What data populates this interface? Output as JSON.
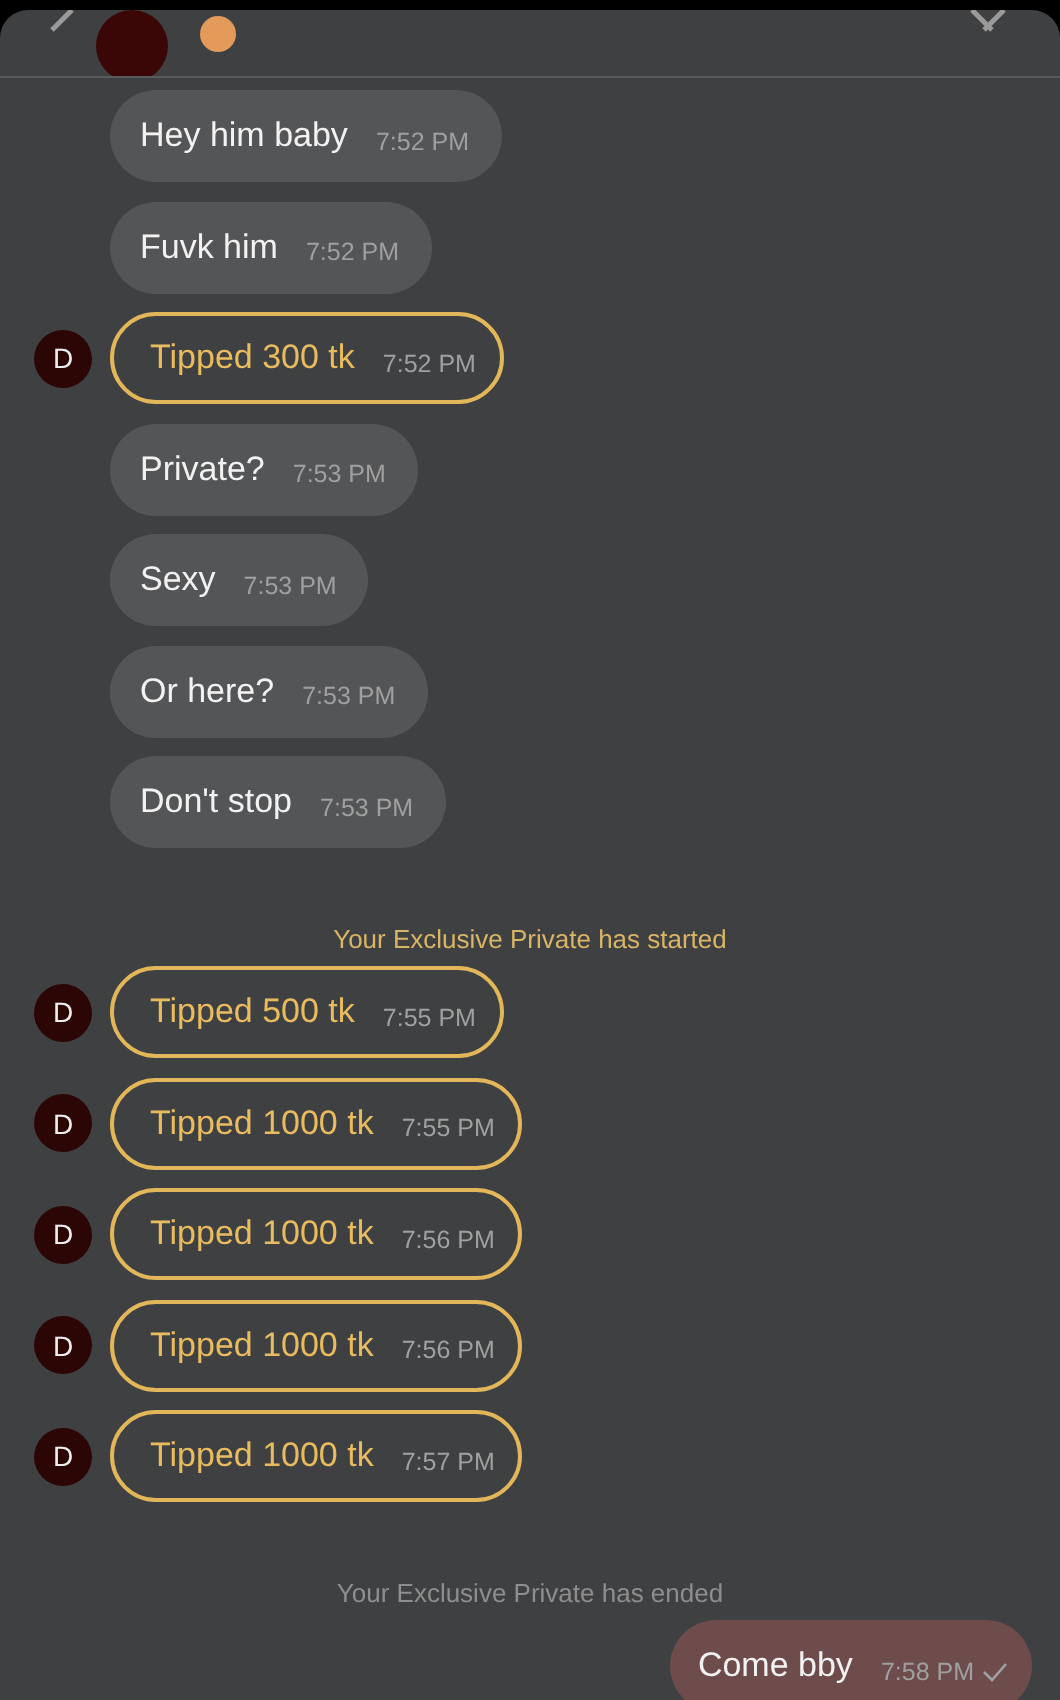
{
  "messages": [
    {
      "kind": "text",
      "text": "Hey him baby",
      "time": "7:52 PM"
    },
    {
      "kind": "text",
      "text": "Fuvk him",
      "time": "7:52 PM"
    },
    {
      "kind": "tip",
      "avatar": "D",
      "text": "Tipped 300 tk",
      "time": "7:52 PM"
    },
    {
      "kind": "text",
      "text": "Private?",
      "time": "7:53 PM"
    },
    {
      "kind": "text",
      "text": "Sexy",
      "time": "7:53 PM"
    },
    {
      "kind": "text",
      "text": "Or here?",
      "time": "7:53 PM"
    },
    {
      "kind": "text",
      "text": "Don't stop",
      "time": "7:53 PM"
    },
    {
      "kind": "system",
      "text": "Your Exclusive Private has started",
      "color": "#d9b565"
    },
    {
      "kind": "tip",
      "avatar": "D",
      "text": "Tipped 500 tk",
      "time": "7:55 PM"
    },
    {
      "kind": "tip",
      "avatar": "D",
      "text": "Tipped 1000 tk",
      "time": "7:55 PM"
    },
    {
      "kind": "tip",
      "avatar": "D",
      "text": "Tipped 1000 tk",
      "time": "7:56 PM"
    },
    {
      "kind": "tip",
      "avatar": "D",
      "text": "Tipped 1000 tk",
      "time": "7:56 PM"
    },
    {
      "kind": "tip",
      "avatar": "D",
      "text": "Tipped 1000 tk",
      "time": "7:57 PM"
    },
    {
      "kind": "system",
      "text": "Your Exclusive Private has ended",
      "color": "#8e8e8e"
    },
    {
      "kind": "outgoing",
      "text": "Come bby",
      "time": "7:58 PM",
      "read": true
    }
  ]
}
